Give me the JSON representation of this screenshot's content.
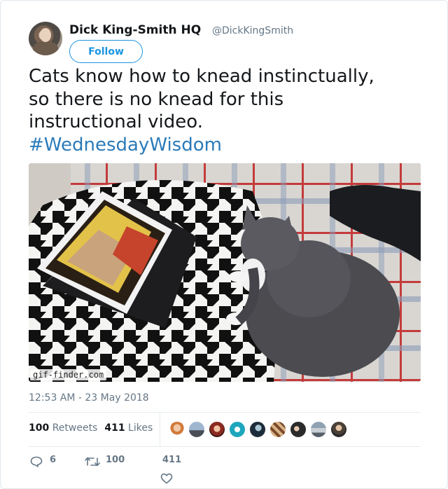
{
  "author": {
    "display_name": "Dick King-Smith HQ",
    "handle": "@DickKingSmith"
  },
  "follow_button": {
    "label": "Follow"
  },
  "tweet": {
    "lines": [
      "Cats know how to knead instinctually,",
      "so there is no knead for this",
      "instructional video."
    ],
    "hashtag": "#WednesdayWisdom"
  },
  "media": {
    "watermark": "gif-finder.com"
  },
  "meta": {
    "timestamp": "12:53 AM - 23 May 2018"
  },
  "stats": {
    "retweets_count": "100",
    "retweets_label": "Retweets",
    "likes_count": "411",
    "likes_label": "Likes"
  },
  "actions": {
    "reply_count": "6",
    "retweet_count": "100",
    "like_count": "411"
  },
  "colors": {
    "link": "#2b7bb9",
    "follow_border": "#1b95e0",
    "secondary_text": "#657786"
  },
  "icons": {
    "reply": "speech-bubble-icon",
    "retweet": "retweet-arrows-icon",
    "like": "heart-icon"
  }
}
